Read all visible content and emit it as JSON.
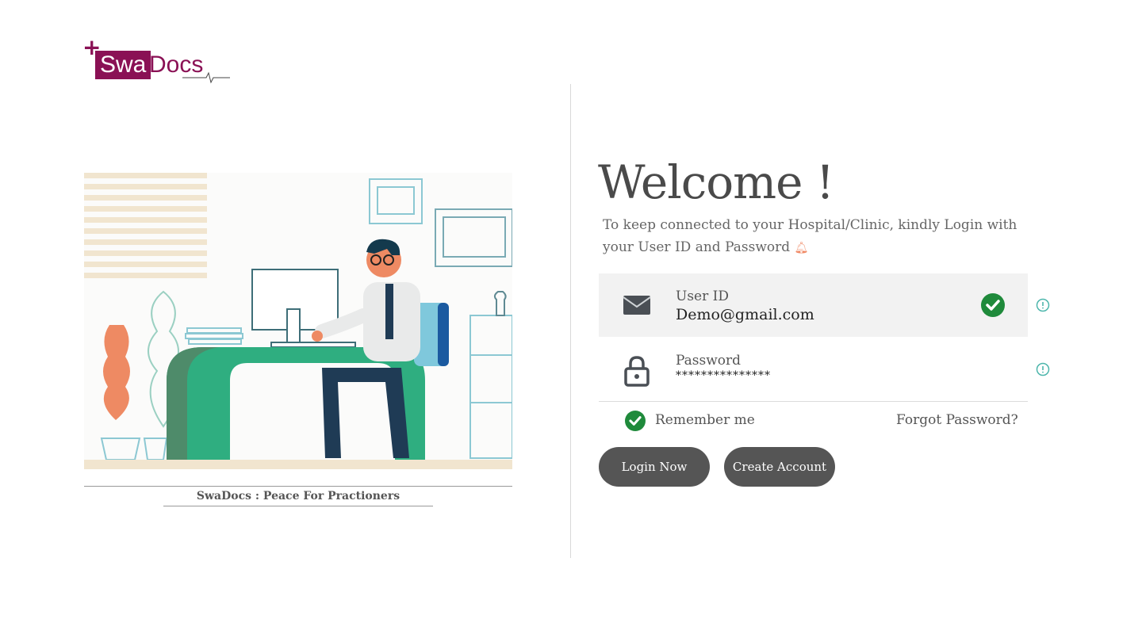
{
  "brand": {
    "logo_plus": "+",
    "logo_part1": "Swa",
    "logo_part2": "Docs",
    "color": "#8a1155"
  },
  "illustration": {
    "caption": "SwaDocs : Peace For Practioners"
  },
  "login": {
    "title": "Welcome !",
    "subtitle": "To keep connected to your Hospital/Clinic, kindly Login with your User ID and Password",
    "subtitle_icon": "bell-icon",
    "user_id": {
      "label": "User ID",
      "value": "Demo@gmail.com",
      "icon": "envelope-icon",
      "status_icon": "check-circle-icon"
    },
    "password": {
      "label": "Password",
      "value": "***************",
      "icon": "lock-icon"
    },
    "remember_label": "Remember me",
    "forgot_label": "Forgot Password?",
    "login_button": "Login Now",
    "create_button": "Create Account"
  },
  "colors": {
    "accent_green": "#1f8a3b",
    "button_bg": "#555555",
    "info_teal": "#4db6ac"
  }
}
